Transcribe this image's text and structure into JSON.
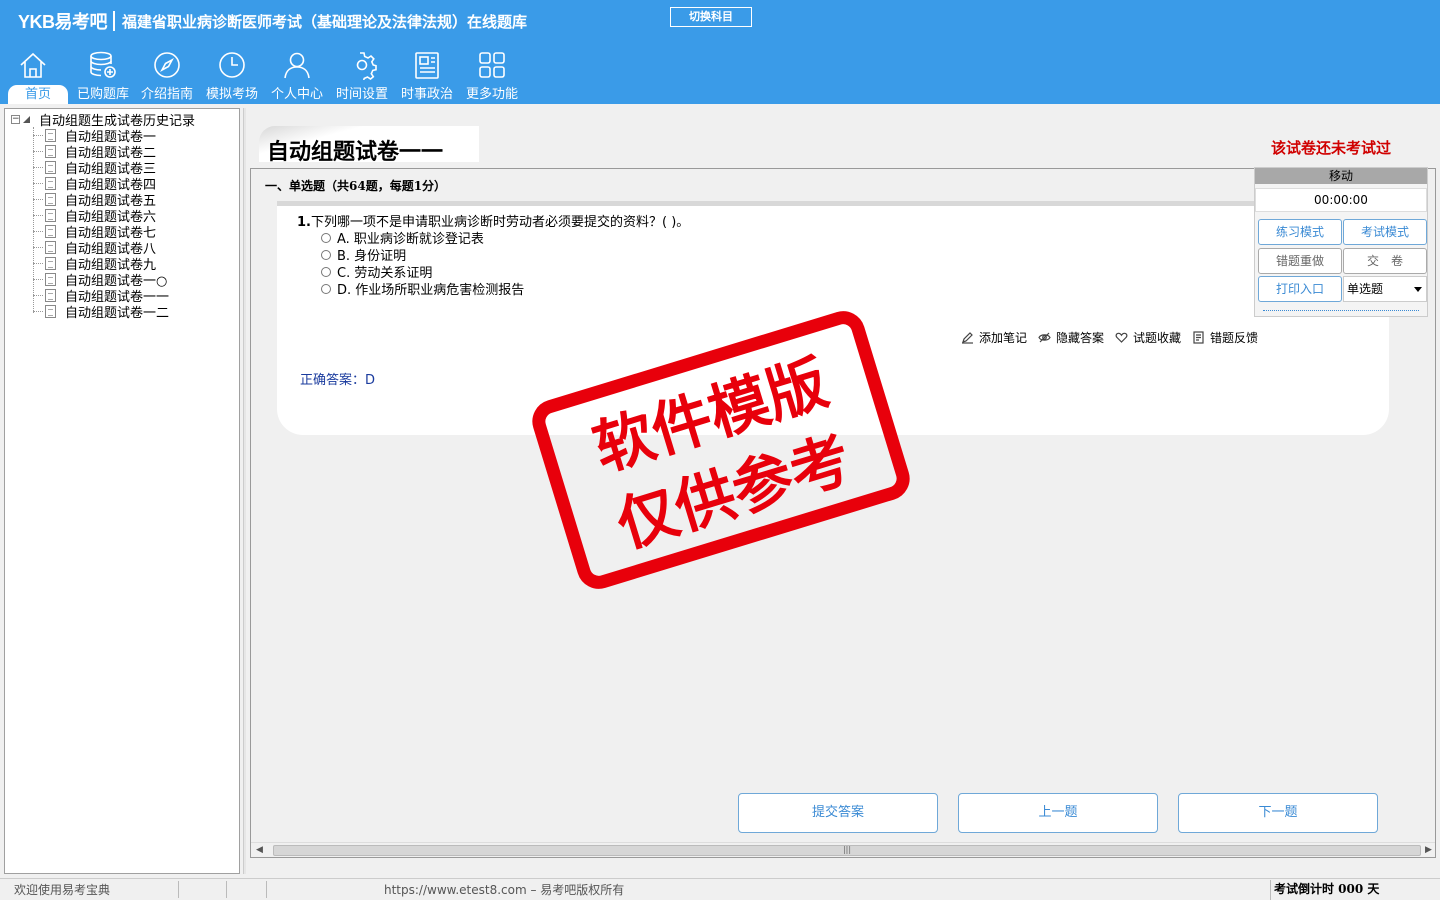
{
  "header": {
    "logo": "YKB易考吧",
    "title": "福建省职业病诊断医师考试（基础理论及法律法规）在线题库",
    "switch_subject": "切换科目",
    "nav": [
      {
        "label": "首页",
        "icon": "home-icon",
        "active": true
      },
      {
        "label": "已购题库",
        "icon": "database-icon"
      },
      {
        "label": "介绍指南",
        "icon": "compass-icon"
      },
      {
        "label": "模拟考场",
        "icon": "clock-icon"
      },
      {
        "label": "个人中心",
        "icon": "user-icon"
      },
      {
        "label": "时间设置",
        "icon": "gear-icon"
      },
      {
        "label": "时事政治",
        "icon": "news-icon"
      },
      {
        "label": "更多功能",
        "icon": "grid-icon"
      }
    ]
  },
  "tree": {
    "root": "自动组题生成试卷历史记录",
    "items": [
      "自动组题试卷一",
      "自动组题试卷二",
      "自动组题试卷三",
      "自动组题试卷四",
      "自动组题试卷五",
      "自动组题试卷六",
      "自动组题试卷七",
      "自动组题试卷八",
      "自动组题试卷九",
      "自动组题试卷一○",
      "自动组题试卷一一",
      "自动组题试卷一二"
    ]
  },
  "paper": {
    "title": "自动组题试卷一一",
    "status": "该试卷还未考试过",
    "section": "一、单选题（共64题，每题1分）"
  },
  "question": {
    "number": "1.",
    "text": "下列哪一项不是申请职业病诊断时劳动者必须要提交的资料？( )。",
    "options": [
      "A. 职业病诊断就诊登记表",
      "B. 身份证明",
      "C. 劳动关系证明",
      "D. 作业场所职业病危害检测报告"
    ],
    "tools": {
      "add_note": "添加笔记",
      "hide_answer": "隐藏答案",
      "favorite": "试题收藏",
      "feedback": "错题反馈"
    },
    "answer_label": "正确答案：",
    "answer_value": "D"
  },
  "buttons": {
    "submit": "提交答案",
    "prev": "上一题",
    "next": "下一题"
  },
  "side_panel": {
    "move": "移动",
    "timer": "00:00:00",
    "practice_mode": "练习模式",
    "exam_mode": "考试模式",
    "redo_wrong": "错题重做",
    "hand_in": "交　卷",
    "print": "打印入口",
    "question_type": "单选题"
  },
  "watermark": {
    "line1": "软件模版",
    "line2": "仅供参考"
  },
  "statusbar": {
    "welcome": "欢迎使用易考宝典",
    "copyright": "https://www.etest8.com – 易考吧版权所有",
    "countdown": "考试倒计时 000 天"
  }
}
